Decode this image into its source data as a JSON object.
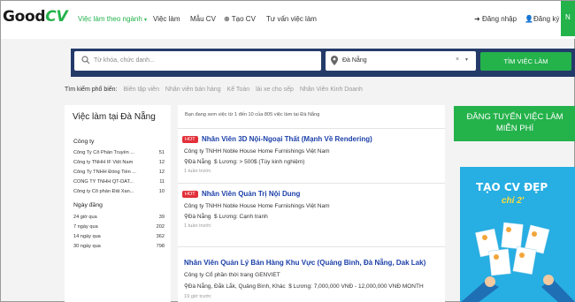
{
  "brand": {
    "logo_part1": "Good",
    "logo_part2": "CV",
    "accent": "#24b24b",
    "navy": "#243b6a",
    "hot_red": "#e2303a",
    "link_blue": "#1b3fa8"
  },
  "nav": {
    "jobs_by_industry": "Việc làm theo ngành",
    "jobs": "Việc làm",
    "cv_templates": "Mẫu CV",
    "create_cv": "Tạo CV",
    "cv_advice": "Tư vấn việc làm",
    "login": "Đăng nhập",
    "register": "Đăng ký"
  },
  "search": {
    "keyword_placeholder": "Từ khóa, chức danh...",
    "location_value": "Đà Nẵng",
    "clear_symbol": "×",
    "button": "TÌM VIỆC LÀM"
  },
  "popular": {
    "label": "Tìm kiếm phổ biến:",
    "terms": [
      "Biên tập viên",
      "Nhân viên bán hàng",
      "Kế Toán",
      "lái xe cho sếp",
      "Nhân Viên Kinh Doanh"
    ]
  },
  "sidebar": {
    "title": "Việc làm tại Đà Nẵng",
    "company_heading": "Công ty",
    "companies": [
      {
        "name": "Công Ty Cổ Phần Truyền ...",
        "count": "51"
      },
      {
        "name": "Công ty TNHH IF Việt Nam",
        "count": "12"
      },
      {
        "name": "Công Ty TNHH Đồng Tiền ...",
        "count": "12"
      },
      {
        "name": "CÔNG TY TNHH QT-DAT...",
        "count": "11"
      },
      {
        "name": "Công ty Cổ phần Đất Xan...",
        "count": "10"
      }
    ],
    "date_heading": "Ngày đăng",
    "dates": [
      {
        "label": "24 giờ qua",
        "count": "39"
      },
      {
        "label": "7 ngày qua",
        "count": "202"
      },
      {
        "label": "14 ngày qua",
        "count": "362"
      },
      {
        "label": "30 ngày qua",
        "count": "798"
      }
    ]
  },
  "results": {
    "summary": "Bạn đang xem việc từ 1 đến 10 của 805 việc làm tại Đà Nẵng",
    "jobs": [
      {
        "hot": "HOT",
        "title": "Nhân Viên 3D Nội-Ngoại Thất (Mạnh Về Rendering)",
        "company": "Công ty TNHH Noble House Home Furnishings Việt Nam",
        "location": "Đà Nẵng",
        "salary": "Lương: > 500$ (Tùy kinh nghiệm)",
        "posted": "1 tuần trước"
      },
      {
        "hot": "HOT",
        "title": "Nhân Viên Quản Trị Nội Dung",
        "company": "Công ty TNHH Noble House Home Furnishings Việt Nam",
        "location": "Đà Nẵng",
        "salary": "Lương: Cạnh tranh",
        "posted": "1 tuần trước"
      },
      {
        "hot": "",
        "title": "Nhân Viên Quản Lý Bán Hàng Khu Vực (Quảng Bình, Đà Nẵng, Dak Lak)",
        "company": "Công ty Cổ phần thời trang GENVIET",
        "location": "Đà Nẵng, Đắk Lắk, Quảng Bình, Khác",
        "salary": "Lương: 7,000,000 VNĐ - 12,000,000 VNĐ MONTH",
        "posted": "19 giờ trước"
      }
    ]
  },
  "promo": {
    "line1": "ĐĂNG TUYỂN VIỆC LÀM",
    "line2": "MIỄN PHÍ"
  },
  "banner": {
    "line1": "TẠO CV ĐẸP",
    "line2": "chỉ 2'"
  }
}
